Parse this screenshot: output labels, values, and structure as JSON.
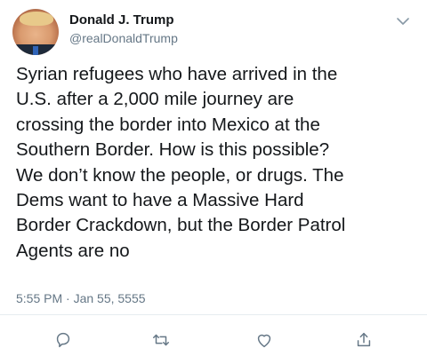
{
  "tweet": {
    "display_name": "Donald J. Trump",
    "handle": "@realDonaldTrump",
    "text": "Syrian refugees who have arrived in the\nU.S. after a 2,000 mile journey are\ncrossing the border into Mexico at the\nSouthern Border. How is this possible?\nWe don’t know the people, or drugs. The\nDems want to have a Massive Hard\nBorder Crackdown, but the Border Patrol\nAgents are no",
    "timestamp": "5:55 PM · Jan 55, 5555"
  },
  "icons": {
    "menu": "chevron-down-icon",
    "reply": "reply-icon",
    "retweet": "retweet-icon",
    "like": "heart-icon",
    "share": "share-icon"
  },
  "colors": {
    "text": "#14171a",
    "secondary": "#657786",
    "icon": "#657786",
    "divider": "#e6ecf0"
  }
}
